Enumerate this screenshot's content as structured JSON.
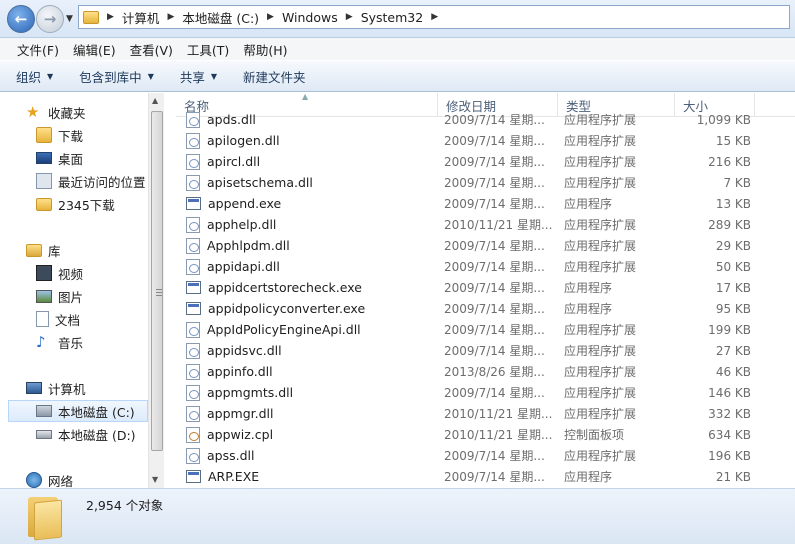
{
  "address": {
    "breadcrumbs": [
      "计算机",
      "本地磁盘 (C:)",
      "Windows",
      "System32"
    ]
  },
  "menu": [
    "文件(F)",
    "编辑(E)",
    "查看(V)",
    "工具(T)",
    "帮助(H)"
  ],
  "toolbar": {
    "organize": "组织",
    "include_library": "包含到库中",
    "share": "共享",
    "new_folder": "新建文件夹"
  },
  "nav": {
    "favorites": "收藏夹",
    "downloads": "下载",
    "desktop": "桌面",
    "recent": "最近访问的位置",
    "dl2345": "2345下载",
    "libraries": "库",
    "videos": "视频",
    "pictures": "图片",
    "documents": "文档",
    "music": "音乐",
    "computer": "计算机",
    "drive_c": "本地磁盘 (C:)",
    "drive_d": "本地磁盘 (D:)",
    "network": "网络"
  },
  "columns": {
    "name": "名称",
    "date": "修改日期",
    "type": "类型",
    "size": "大小"
  },
  "files": [
    {
      "name": "apds.dll",
      "date": "2009/7/14 星期...",
      "type": "应用程序扩展",
      "size": "1,099 KB",
      "icon": "dll"
    },
    {
      "name": "apilogen.dll",
      "date": "2009/7/14 星期...",
      "type": "应用程序扩展",
      "size": "15 KB",
      "icon": "dll"
    },
    {
      "name": "apircl.dll",
      "date": "2009/7/14 星期...",
      "type": "应用程序扩展",
      "size": "216 KB",
      "icon": "dll"
    },
    {
      "name": "apisetschema.dll",
      "date": "2009/7/14 星期...",
      "type": "应用程序扩展",
      "size": "7 KB",
      "icon": "dll"
    },
    {
      "name": "append.exe",
      "date": "2009/7/14 星期...",
      "type": "应用程序",
      "size": "13 KB",
      "icon": "exe"
    },
    {
      "name": "apphelp.dll",
      "date": "2010/11/21 星期...",
      "type": "应用程序扩展",
      "size": "289 KB",
      "icon": "dll"
    },
    {
      "name": "Apphlpdm.dll",
      "date": "2009/7/14 星期...",
      "type": "应用程序扩展",
      "size": "29 KB",
      "icon": "dll"
    },
    {
      "name": "appidapi.dll",
      "date": "2009/7/14 星期...",
      "type": "应用程序扩展",
      "size": "50 KB",
      "icon": "dll"
    },
    {
      "name": "appidcertstorecheck.exe",
      "date": "2009/7/14 星期...",
      "type": "应用程序",
      "size": "17 KB",
      "icon": "exe"
    },
    {
      "name": "appidpolicyconverter.exe",
      "date": "2009/7/14 星期...",
      "type": "应用程序",
      "size": "95 KB",
      "icon": "exe"
    },
    {
      "name": "AppIdPolicyEngineApi.dll",
      "date": "2009/7/14 星期...",
      "type": "应用程序扩展",
      "size": "199 KB",
      "icon": "dll"
    },
    {
      "name": "appidsvc.dll",
      "date": "2009/7/14 星期...",
      "type": "应用程序扩展",
      "size": "27 KB",
      "icon": "dll"
    },
    {
      "name": "appinfo.dll",
      "date": "2013/8/26 星期...",
      "type": "应用程序扩展",
      "size": "46 KB",
      "icon": "dll"
    },
    {
      "name": "appmgmts.dll",
      "date": "2009/7/14 星期...",
      "type": "应用程序扩展",
      "size": "146 KB",
      "icon": "dll"
    },
    {
      "name": "appmgr.dll",
      "date": "2010/11/21 星期...",
      "type": "应用程序扩展",
      "size": "332 KB",
      "icon": "dll"
    },
    {
      "name": "appwiz.cpl",
      "date": "2010/11/21 星期...",
      "type": "控制面板项",
      "size": "634 KB",
      "icon": "cpl"
    },
    {
      "name": "apss.dll",
      "date": "2009/7/14 星期...",
      "type": "应用程序扩展",
      "size": "196 KB",
      "icon": "dll"
    },
    {
      "name": "ARP.EXE",
      "date": "2009/7/14 星期...",
      "type": "应用程序",
      "size": "21 KB",
      "icon": "exe"
    }
  ],
  "status": {
    "count": "2,954 个对象"
  }
}
